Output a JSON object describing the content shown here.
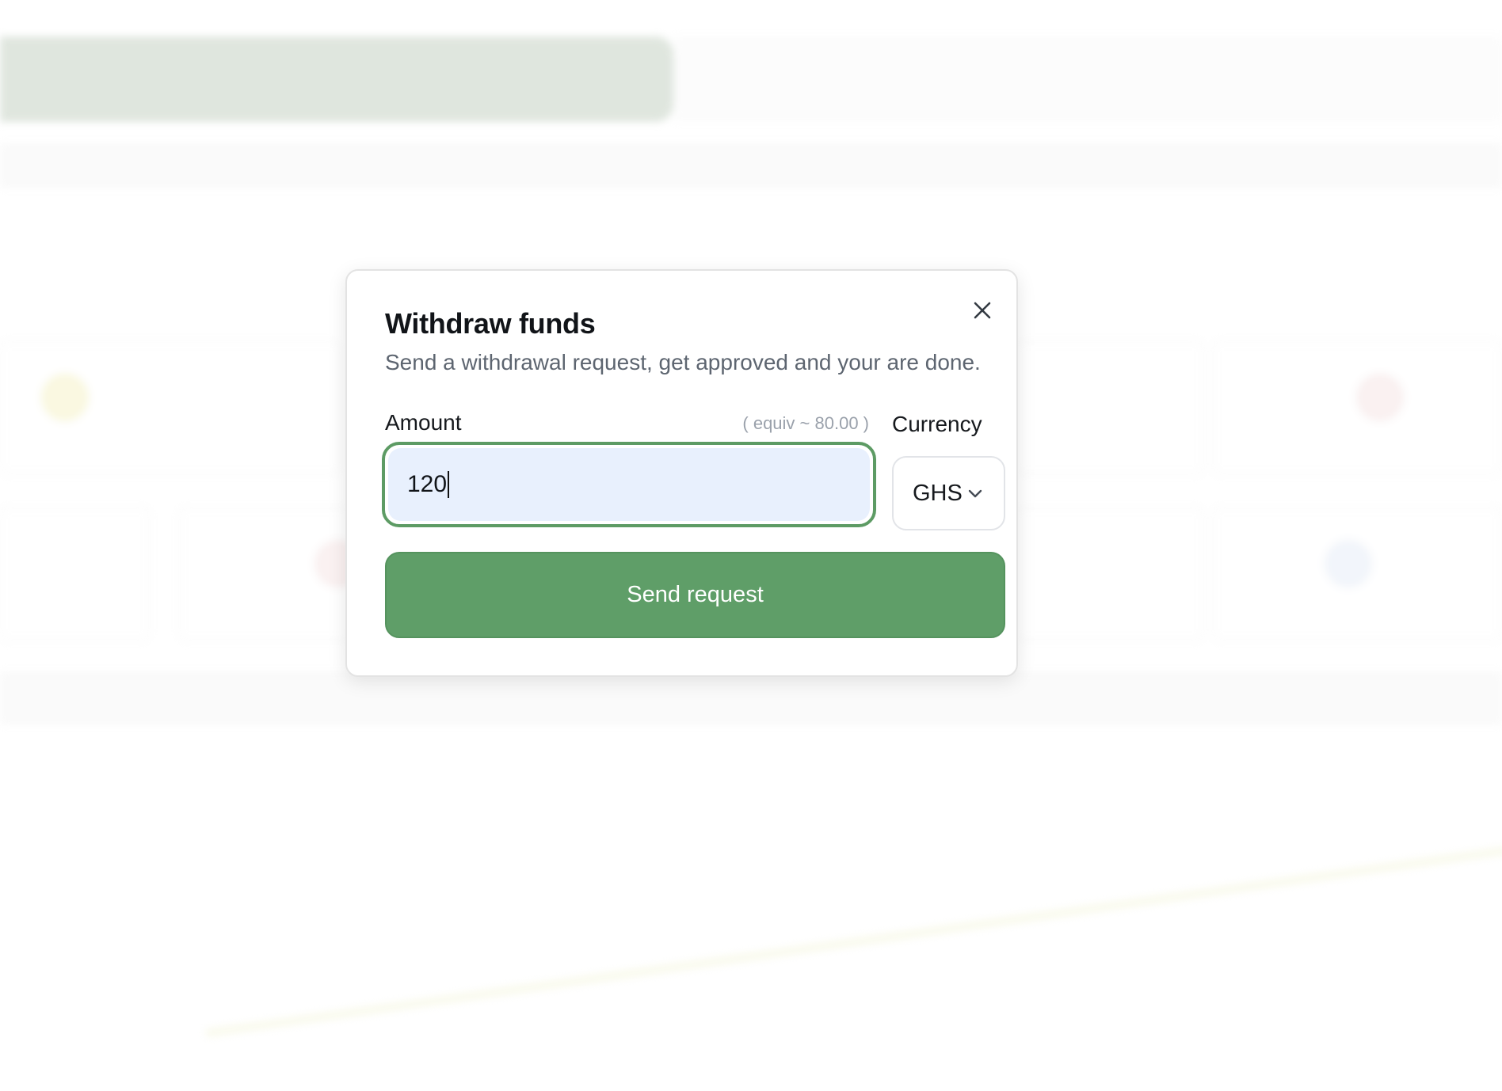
{
  "modal": {
    "title": "Withdraw funds",
    "subtitle": "Send a withdrawal request, get approved and your are done.",
    "close_icon": "close-icon",
    "amount": {
      "label": "Amount",
      "equiv_note": "( equiv ~ 80.00 )",
      "value": "120"
    },
    "currency": {
      "label": "Currency",
      "selected": "GHS",
      "icon": "chevron-down-icon"
    },
    "submit_label": "Send request"
  },
  "colors": {
    "accent": "#5f9e68",
    "focus_ring": "#5d9b64",
    "input_fill": "#e8f0fd",
    "title_text": "#111418",
    "muted_text": "#5d6570"
  }
}
